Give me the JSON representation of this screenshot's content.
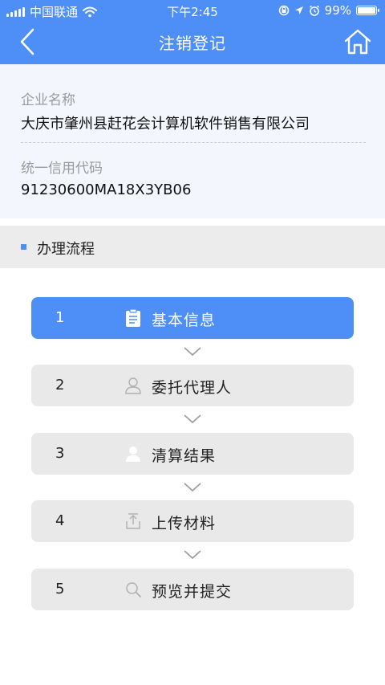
{
  "status_bar": {
    "carrier": "中国联通",
    "time": "下午2:45",
    "battery": "99%",
    "battery_level": 0.99
  },
  "nav": {
    "title": "注销登记",
    "back_icon": "chevron-left-icon",
    "home_icon": "home-icon"
  },
  "company": {
    "name_label": "企业名称",
    "name_value": "大庆市肇州县赶花会计算机软件销售有限公司",
    "code_label": "统一信用代码",
    "code_value": "91230600MA18X3YB06"
  },
  "process": {
    "title": "办理流程",
    "steps": [
      {
        "num": "1",
        "label": "基本信息",
        "icon": "clipboard-icon",
        "active": true
      },
      {
        "num": "2",
        "label": "委托代理人",
        "icon": "person-outline-icon",
        "active": false
      },
      {
        "num": "3",
        "label": "清算结果",
        "icon": "person-icon",
        "active": false
      },
      {
        "num": "4",
        "label": "上传材料",
        "icon": "upload-icon",
        "active": false
      },
      {
        "num": "5",
        "label": "预览并提交",
        "icon": "search-icon",
        "active": false
      }
    ]
  },
  "colors": {
    "primary": "#4d8ef7",
    "info_bg": "#f3f7fd",
    "step_bg": "#e9e9e9"
  }
}
